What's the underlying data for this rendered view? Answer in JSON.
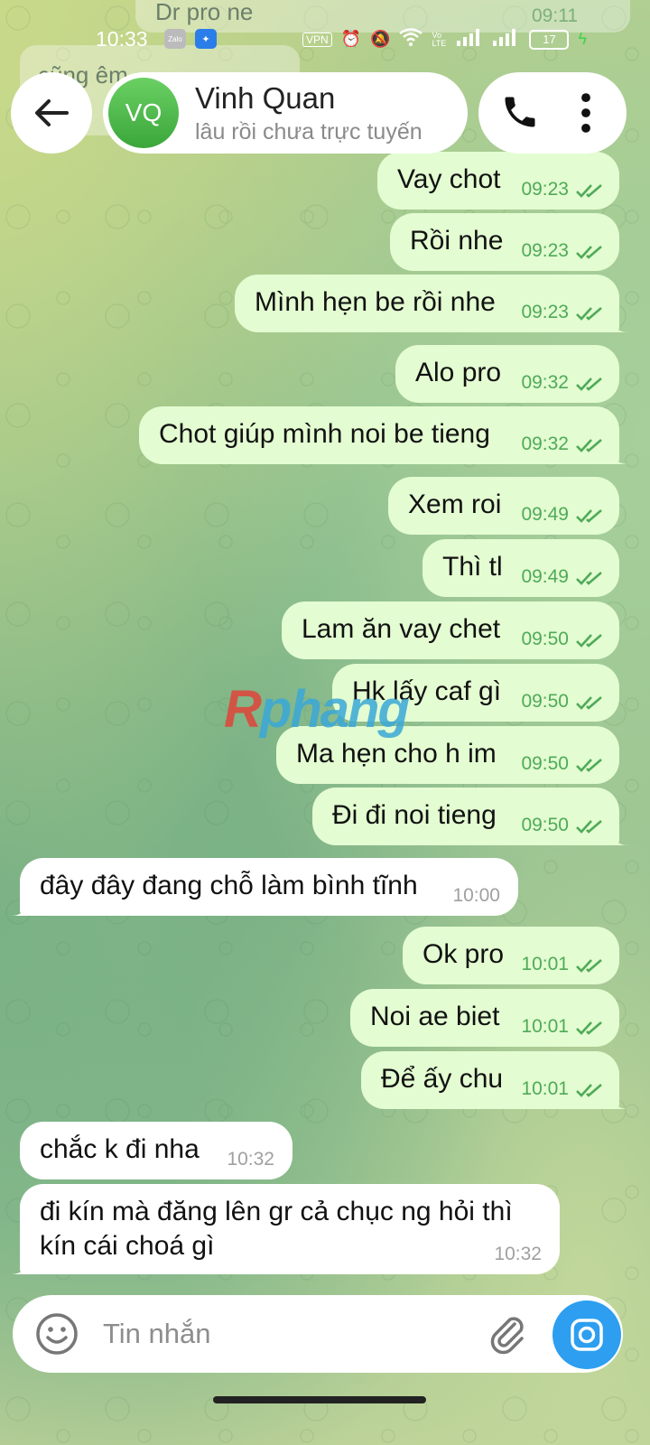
{
  "status_bar": {
    "time": "10:33",
    "vpn": "VPN",
    "volte": "Vo LTE",
    "battery": "17"
  },
  "ghost_messages": {
    "top_out": "Dr pro ne",
    "top_out_time": "09:11",
    "left_in": "cũng êm"
  },
  "header": {
    "avatar_initials": "VQ",
    "name": "Vinh Quan",
    "status": "lâu rồi chưa trực tuyến"
  },
  "messages": [
    {
      "dir": "out",
      "text": "Vay chot",
      "time": "09:23"
    },
    {
      "dir": "out",
      "text": "Rồi nhe",
      "time": "09:23"
    },
    {
      "dir": "out",
      "text": "Mình hẹn be rồi nhe",
      "time": "09:23"
    },
    {
      "dir": "out",
      "text": "Alo pro",
      "time": "09:32"
    },
    {
      "dir": "out",
      "text": "Chot giúp mình noi be tieng",
      "time": "09:32"
    },
    {
      "dir": "out",
      "text": "Xem roi",
      "time": "09:49"
    },
    {
      "dir": "out",
      "text": "Thì tl",
      "time": "09:49"
    },
    {
      "dir": "out",
      "text": "Lam ăn vay chet",
      "time": "09:50"
    },
    {
      "dir": "out",
      "text": "Hk lấy caf gì",
      "time": "09:50"
    },
    {
      "dir": "out",
      "text": "Ma hẹn cho h im",
      "time": "09:50"
    },
    {
      "dir": "out",
      "text": "Đi đi noi tieng",
      "time": "09:50"
    },
    {
      "dir": "in",
      "text": "đây đây đang chỗ làm bình tĩnh",
      "time": "10:00"
    },
    {
      "dir": "out",
      "text": "Ok pro",
      "time": "10:01"
    },
    {
      "dir": "out",
      "text": "Noi ae biet",
      "time": "10:01"
    },
    {
      "dir": "out",
      "text": "Để ấy chu",
      "time": "10:01"
    },
    {
      "dir": "in",
      "text": "chắc k đi nha",
      "time": "10:32"
    },
    {
      "dir": "in",
      "text": "đi kín mà đăng lên gr cả chục ng hỏi thì",
      "text2": "kín cái choá gì",
      "time": "10:32"
    }
  ],
  "watermark": {
    "part1": "R",
    "part2": "phang"
  },
  "composer": {
    "placeholder": "Tin nhắn"
  },
  "colors": {
    "outgoing_bubble": "#e3fcd1",
    "incoming_bubble": "#ffffff",
    "accent": "#2d9ef0",
    "avatar": "#4cb84a",
    "read_tick": "#4faa58"
  }
}
